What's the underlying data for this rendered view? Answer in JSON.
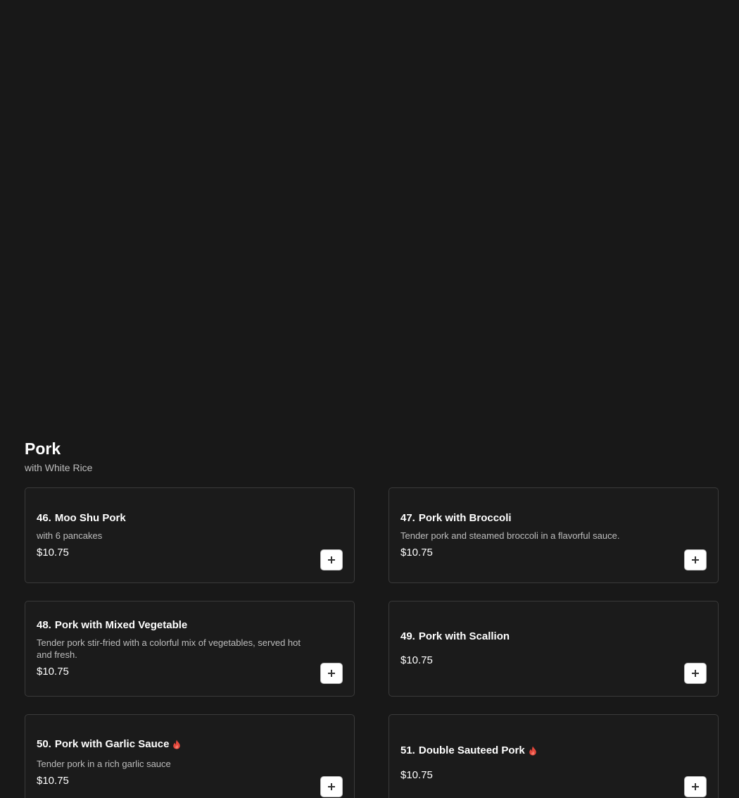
{
  "section": {
    "title": "Pork",
    "subtitle": "with White Rice"
  },
  "colors": {
    "background": "#181818",
    "card_border": "#3a3a3a",
    "spicy": "#e5483c"
  },
  "items": [
    {
      "number": "46.",
      "name": "Moo Shu Pork",
      "description": "with 6 pancakes",
      "price": "$10.75",
      "spicy": false
    },
    {
      "number": "47.",
      "name": "Pork with Broccoli",
      "description": "Tender pork and steamed broccoli in a flavorful sauce.",
      "price": "$10.75",
      "spicy": false
    },
    {
      "number": "48.",
      "name": "Pork with Mixed Vegetable",
      "description": "Tender pork stir-fried with a colorful mix of vegetables, served hot and fresh.",
      "price": "$10.75",
      "spicy": false
    },
    {
      "number": "49.",
      "name": "Pork with Scallion",
      "description": "",
      "price": "$10.75",
      "spicy": false
    },
    {
      "number": "50.",
      "name": "Pork with Garlic Sauce",
      "description": "Tender pork in a rich garlic sauce",
      "price": "$10.75",
      "spicy": true,
      "icon": "spicy-flame-icon"
    },
    {
      "number": "51.",
      "name": "Double Sauteed Pork",
      "description": "",
      "price": "$10.75",
      "spicy": true,
      "icon": "spicy-flame-icon"
    }
  ],
  "icons": {
    "add": "plus-icon",
    "spicy": "spicy-flame-icon"
  }
}
